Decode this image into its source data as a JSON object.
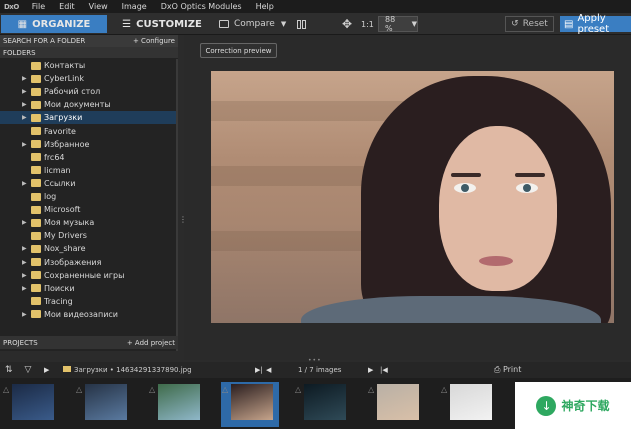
{
  "app": {
    "logo": "DxO"
  },
  "menu": [
    "File",
    "Edit",
    "View",
    "Image",
    "DxO Optics Modules",
    "Help"
  ],
  "toolbar": {
    "organize": "ORGANIZE",
    "customize": "CUSTOMIZE",
    "compare": "Compare",
    "fit": "1:1",
    "zoom": "88 %",
    "reset": "Reset",
    "apply_preset": "Apply preset"
  },
  "left_panel": {
    "search_header": "SEARCH FOR A FOLDER",
    "configure": "+ Configure",
    "folders_header": "FOLDERS",
    "tree": [
      {
        "label": "Контакты",
        "arrow": false
      },
      {
        "label": "CyberLink",
        "arrow": true
      },
      {
        "label": "Рабочий стол",
        "arrow": true
      },
      {
        "label": "Мои документы",
        "arrow": true
      },
      {
        "label": "Загрузки",
        "arrow": true,
        "selected": true
      },
      {
        "label": "Favorite",
        "arrow": false
      },
      {
        "label": "Избранное",
        "arrow": true
      },
      {
        "label": "frc64",
        "arrow": false
      },
      {
        "label": "licman",
        "arrow": false
      },
      {
        "label": "Ссылки",
        "arrow": true
      },
      {
        "label": "log",
        "arrow": false
      },
      {
        "label": "Microsoft",
        "arrow": false
      },
      {
        "label": "Моя музыка",
        "arrow": true
      },
      {
        "label": "My Drivers",
        "arrow": false
      },
      {
        "label": "Nox_share",
        "arrow": true
      },
      {
        "label": "Изображения",
        "arrow": true
      },
      {
        "label": "Сохраненные игры",
        "arrow": true
      },
      {
        "label": "Поиски",
        "arrow": true
      },
      {
        "label": "Tracing",
        "arrow": false
      },
      {
        "label": "Мои видеозаписи",
        "arrow": true
      }
    ],
    "projects_header": "PROJECTS",
    "add_project": "+ Add project"
  },
  "viewer": {
    "correction_preview": "Correction preview"
  },
  "browser": {
    "path": "Загрузки • 14634291337890.jpg",
    "count": "1 / 7  images",
    "print": "Print"
  },
  "filmstrip": [
    {
      "colors": [
        "#1b2a45",
        "#3a5b8a"
      ]
    },
    {
      "colors": [
        "#263346",
        "#5a7aa0"
      ]
    },
    {
      "colors": [
        "#3f6b4a",
        "#8fb7c9"
      ]
    },
    {
      "colors": [
        "#2a1e1f",
        "#c6a48b"
      ],
      "selected": true
    },
    {
      "colors": [
        "#0d1a22",
        "#2f4a57"
      ]
    },
    {
      "colors": [
        "#b9b0a5",
        "#d9c0a8"
      ]
    },
    {
      "colors": [
        "#d8d8d8",
        "#f2f2f2"
      ]
    }
  ],
  "watermark": {
    "text": "神奇下载"
  }
}
